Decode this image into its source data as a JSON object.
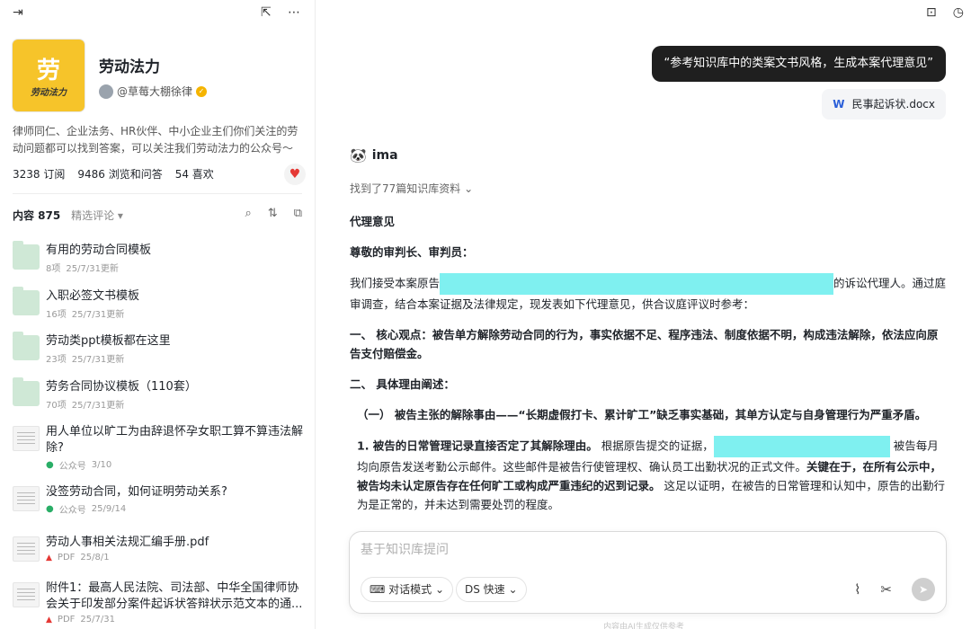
{
  "left": {
    "icons": {
      "collapse": "sidebar-collapse-icon",
      "share": "share-icon",
      "more": "more-icon"
    },
    "cover": {
      "big": "劳",
      "small": "劳动法力"
    },
    "title": "劳动法力",
    "author": "@草莓大棚徐律",
    "description": "律师同仁、企业法务、HR伙伴、中小企业主们你们关注的劳动问题都可以找到答案，可以关注我们劳动法力的公众号～",
    "stats": {
      "subscribe": "3238 订阅",
      "views": "9486 浏览和问答",
      "likes": "54 喜欢"
    },
    "content_label": "内容 875",
    "filter_label": "精选评论 ▾",
    "items": [
      {
        "title": "有用的劳动合同模板",
        "count": "8项",
        "updated": "25/7/31更新"
      },
      {
        "title": "入职必签文书模板",
        "count": "16项",
        "updated": "25/7/31更新"
      },
      {
        "title": "劳动类ppt模板都在这里",
        "count": "23项",
        "updated": "25/7/31更新"
      },
      {
        "title": "劳务合同协议模板（110套）",
        "count": "70项",
        "updated": "25/7/31更新"
      },
      {
        "title": "用人单位以旷工为由辞退怀孕女职工算不算违法解除?",
        "source": "公众号",
        "date": "3/10"
      },
      {
        "title": "没签劳动合同，如何证明劳动关系?",
        "source": "公众号",
        "date": "25/9/14"
      },
      {
        "title": "劳动人事相关法规汇编手册.pdf",
        "source": "PDF",
        "date": "25/8/1"
      },
      {
        "title": "附件1：最高人民法院、司法部、中华全国律师协会关于印发部分案件起诉状答辩状示范文本的通...",
        "source": "PDF",
        "date": "25/7/31"
      }
    ]
  },
  "right": {
    "user_message": "“参考知识库中的类案文书风格，生成本案代理意见”",
    "attachment": "民事起诉状.docx",
    "ai_name": "ima",
    "found": "找到了77篇知识库资料",
    "answer": {
      "title": "代理意见",
      "salutation": "尊敬的审判长、审判员：",
      "intro_a": "我们接受本案原告",
      "intro_b": "的诉讼代理人。通过庭审调查，结合本案证据及法律规定，现发表如下代理意见，供合议庭评议时参考：",
      "core": "一、 核心观点：被告单方解除劳动合同的行为，事实依据不足、程序违法、制度依据不明，构成违法解除，依法应向原告支付赔偿金。",
      "section2": "二、 具体理由阐述：",
      "sub1": "（一） 被告主张的解除事由——“长期虚假打卡、累计旷工”缺乏事实基础，其单方认定与自身管理行为严重矛盾。",
      "p1_lead": "1. 被告的日常管理记录直接否定了其解除理由。",
      "p1_a": " 根据原告提交的证据，",
      "p1_b": " 被告每月均向原告发送考勤公示邮件。这些邮件是被告行使管理权、确认员工出勤状况的正式文件。",
      "p1_bold": "关键在于，在所有公示中，被告均未认定原告存在任何旷工或构成严重违纪的迟到记录。",
      "p1_c": " 这足以证明，在被告的日常管理和认知中，原告的出勤行为是正常的，并未达到需要处罚的程度。"
    },
    "composer": {
      "placeholder": "基于知识库提问",
      "mode": "对话模式",
      "model": "DS 快速"
    },
    "footnote": "内容由AI生成仅供参考"
  }
}
